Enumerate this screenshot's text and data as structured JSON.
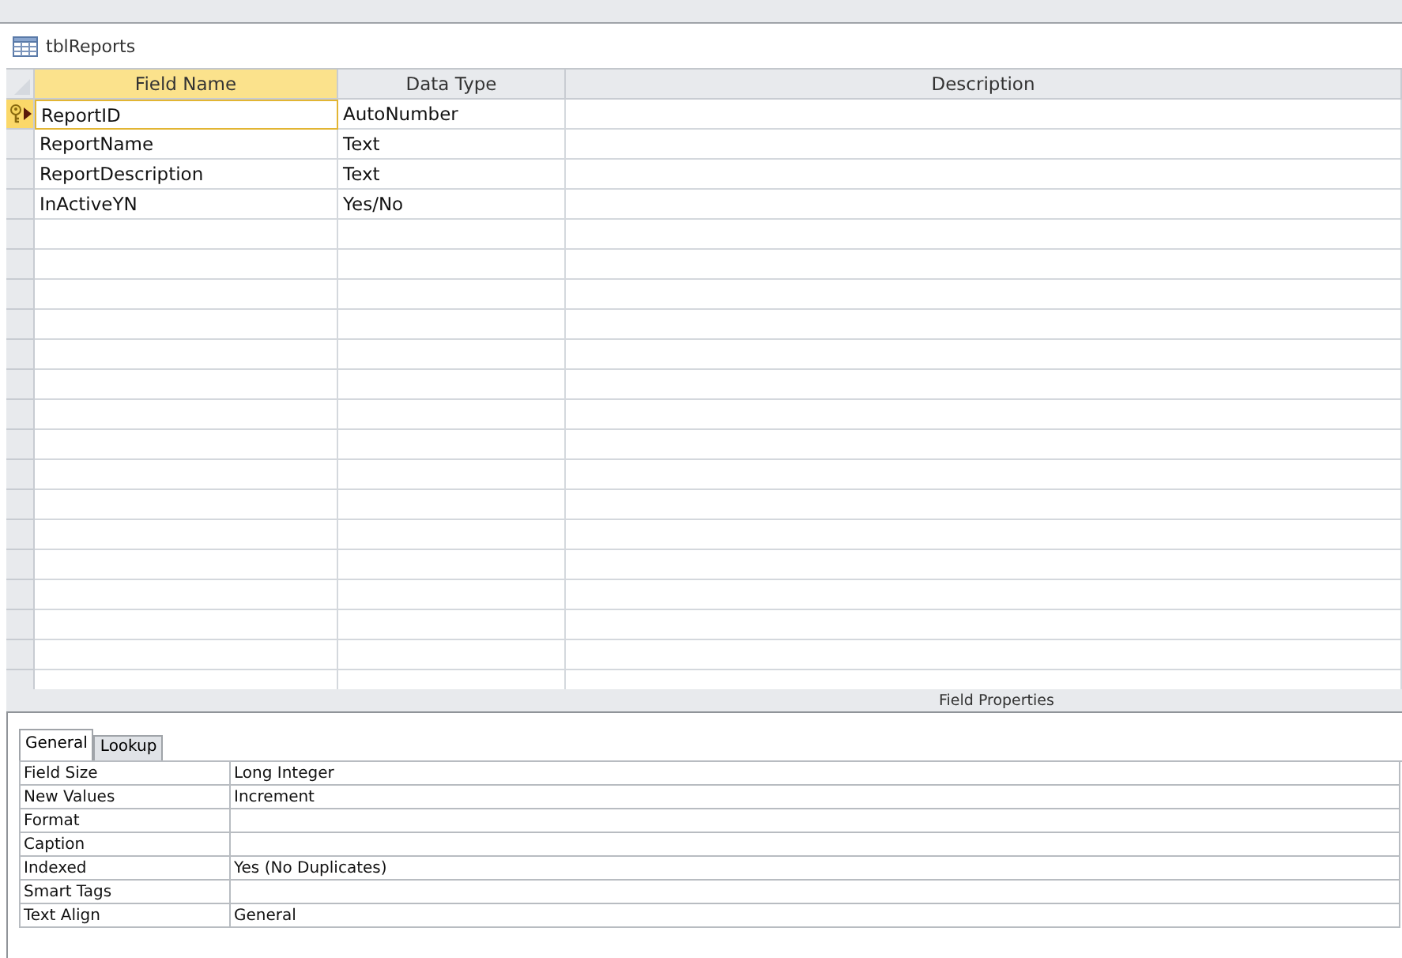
{
  "document_tab": {
    "title": "tblReports"
  },
  "design_grid": {
    "columns": [
      {
        "label": "Field Name",
        "selected": true
      },
      {
        "label": "Data Type",
        "selected": false
      },
      {
        "label": "Description",
        "selected": false
      }
    ],
    "rows": [
      {
        "field_name": "ReportID",
        "data_type": "AutoNumber",
        "selected": true,
        "primary_key": true
      },
      {
        "field_name": "ReportName",
        "data_type": "Text",
        "selected": false,
        "primary_key": false
      },
      {
        "field_name": "ReportDescription",
        "data_type": "Text",
        "selected": false,
        "primary_key": false
      },
      {
        "field_name": "InActiveYN",
        "data_type": "Yes/No",
        "selected": false,
        "primary_key": false
      }
    ]
  },
  "field_properties": {
    "title": "Field Properties",
    "tabs": [
      {
        "label": "General",
        "selected": true
      },
      {
        "label": "Lookup",
        "selected": false
      }
    ],
    "properties": [
      {
        "label": "Field Size",
        "value": "Long Integer"
      },
      {
        "label": "New Values",
        "value": "Increment"
      },
      {
        "label": "Format"
      },
      {
        "label": "Caption"
      },
      {
        "label": "Indexed",
        "value": "Yes (No Duplicates)"
      },
      {
        "label": "Smart Tags"
      },
      {
        "label": "Text Align",
        "value": "General"
      }
    ]
  }
}
